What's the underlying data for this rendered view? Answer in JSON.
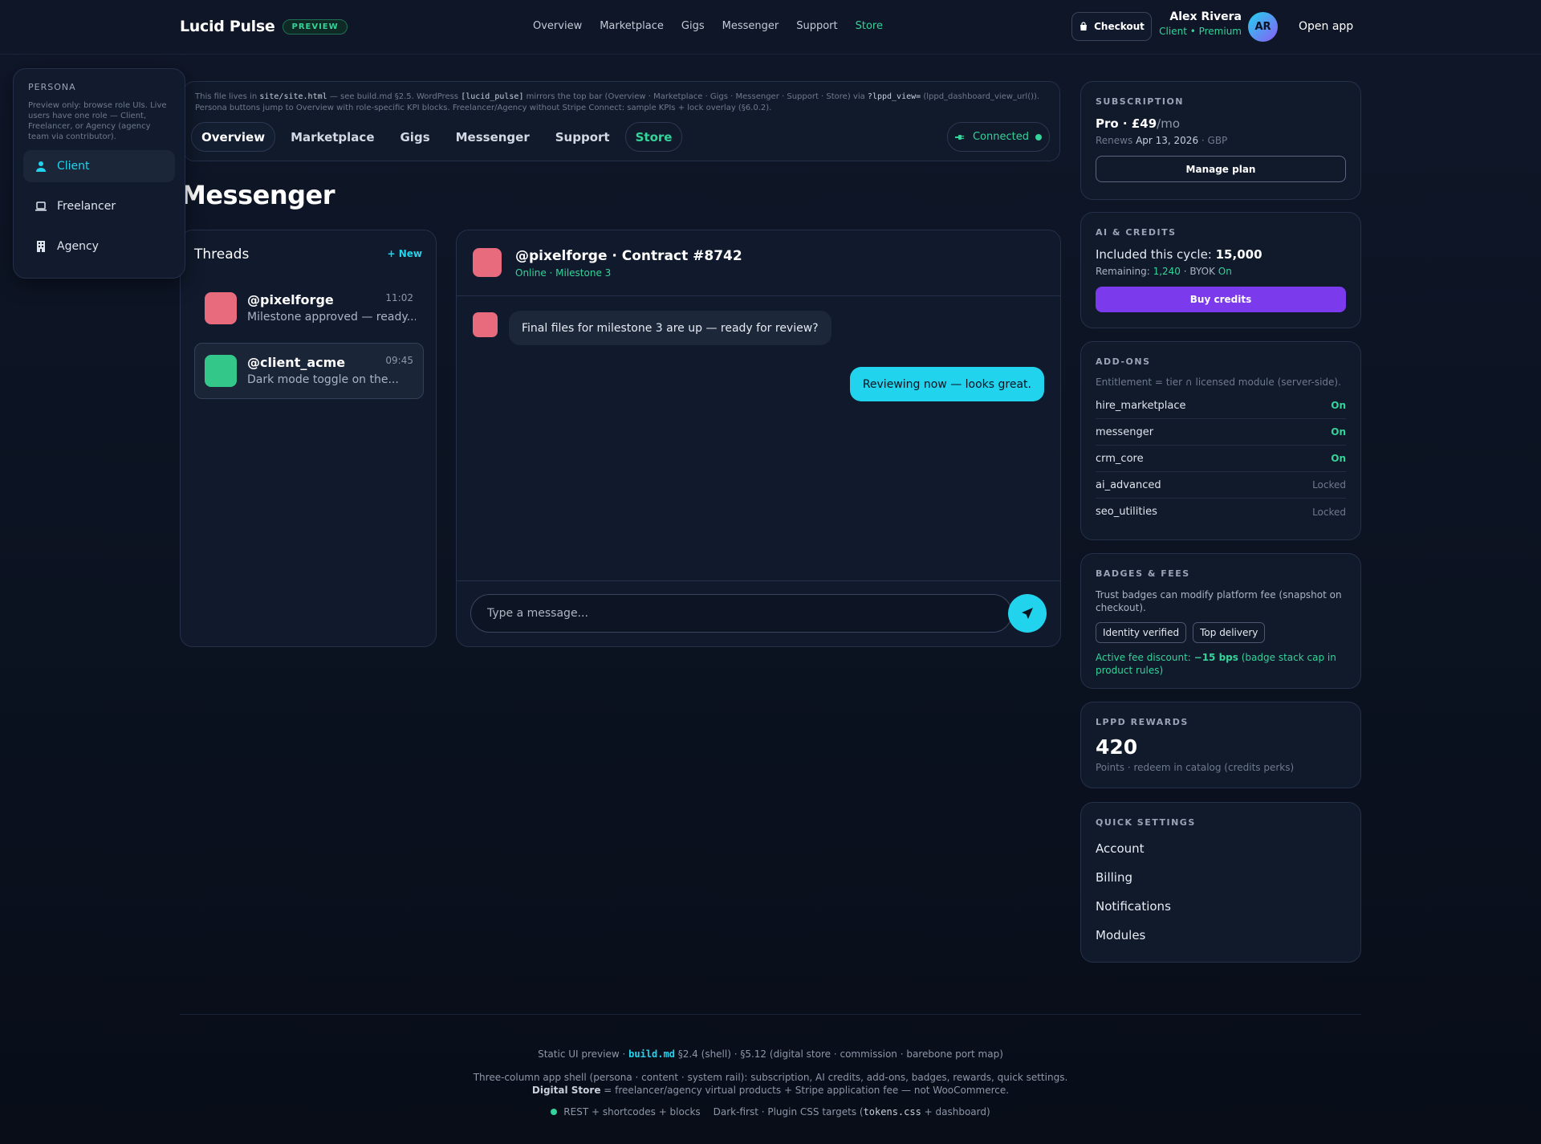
{
  "topbar": {
    "brand": "Lucid Pulse",
    "badge": "PREVIEW",
    "nav": [
      "Overview",
      "Marketplace",
      "Gigs",
      "Messenger",
      "Support",
      "Store"
    ],
    "active_nav": "Store",
    "checkout": "Checkout",
    "user_name": "Alex Rivera",
    "user_role": "Client • Premium",
    "avatar_initials": "AR",
    "open_app": "Open app"
  },
  "persona": {
    "title": "PERSONA",
    "description": "Preview only: browse role UIs. Live users have one role — Client, Freelancer, or Agency (agency team via contributor).",
    "items": [
      {
        "label": "Client",
        "icon": "user-icon",
        "active": true
      },
      {
        "label": "Freelancer",
        "icon": "laptop-icon",
        "active": false
      },
      {
        "label": "Agency",
        "icon": "building-icon",
        "active": false
      }
    ]
  },
  "infobar": {
    "p1": "This file lives in ",
    "file": "site/site.html",
    "p2": " — see build.md §2.5. WordPress ",
    "shortcode": "[lucid_pulse]",
    "p3": " mirrors the top bar (Overview · Marketplace · Gigs · Messenger · Support · Store) via ",
    "param": "?lppd_view=",
    "p4": " (lppd_dashboard_view_url()). Persona buttons jump to Overview with role-specific KPI blocks. Freelancer/Agency without Stripe Connect: sample KPIs + lock overlay (§6.0.2).",
    "tabs": [
      "Overview",
      "Marketplace",
      "Gigs",
      "Messenger",
      "Support",
      "Store"
    ],
    "status": "Connected"
  },
  "page_title": "Messenger",
  "threads": {
    "title": "Threads",
    "new_label": "+ New",
    "items": [
      {
        "name": "@pixelforge",
        "time": "11:02",
        "preview": "Milestone approved — ready...",
        "color": "#e86a7d"
      },
      {
        "name": "@client_acme",
        "time": "09:45",
        "preview": "Dark mode toggle on the...",
        "color": "#34c78a"
      }
    ]
  },
  "chat": {
    "title": "@pixelforge · Contract #8742",
    "subtitle": "Online · Milestone 3",
    "messages": [
      {
        "direction": "in",
        "text": "Final files for milestone 3 are up — ready for review?"
      },
      {
        "direction": "out",
        "text": "Reviewing now — looks great."
      }
    ],
    "input_placeholder": "Type a message...",
    "input_value": ""
  },
  "subscription": {
    "title": "SUBSCRIPTION",
    "plan": "Pro · £49",
    "period": "/mo",
    "renews_label": "Renews ",
    "renews_date": "Apr 13, 2026",
    "currency": " · GBP",
    "button": "Manage plan"
  },
  "credits": {
    "title": "AI & CREDITS",
    "included_label": "Included this cycle: ",
    "included_value": "15,000",
    "remaining_label": "Remaining: ",
    "remaining_value": "1,240",
    "byok_label": " · BYOK ",
    "byok_value": "On",
    "button": "Buy credits"
  },
  "addons": {
    "title": "ADD-ONS",
    "note": "Entitlement = tier ∩ licensed module (server-side).",
    "items": [
      {
        "name": "hire_marketplace",
        "status": "On"
      },
      {
        "name": "messenger",
        "status": "On"
      },
      {
        "name": "crm_core",
        "status": "On"
      },
      {
        "name": "ai_advanced",
        "status": "Locked"
      },
      {
        "name": "seo_utilities",
        "status": "Locked"
      }
    ]
  },
  "badges": {
    "title": "BADGES & FEES",
    "note": "Trust badges can modify platform fee (snapshot on checkout).",
    "chips": [
      "Identity verified",
      "Top delivery"
    ],
    "fee_label": "Active fee discount: ",
    "fee_value": "−15 bps",
    "fee_note": " (badge stack cap in product rules)"
  },
  "rewards": {
    "title": "LPPD REWARDS",
    "points": "420",
    "subtitle": "Points · redeem in catalog (credits perks)"
  },
  "quick_settings": {
    "title": "QUICK SETTINGS",
    "items": [
      "Account",
      "Billing",
      "Notifications",
      "Modules"
    ]
  },
  "footer": {
    "l1a": "Static UI preview · ",
    "l1code": "build.md",
    "l1b": " §2.4 (shell) · §5.12 (digital store · commission · barebone port map)",
    "l2a": "Three-column app shell (persona · content · system rail): subscription, AI credits, add-ons, badges, rewards, quick settings. ",
    "l2b": "Digital Store",
    "l2c": " = freelancer/agency virtual products + Stripe application fee — not WooCommerce.",
    "l3a": "REST + shortcodes + blocks",
    "l3b": "Dark-first · Plugin CSS targets (",
    "l3code": "tokens.css",
    "l3c": " + dashboard)"
  }
}
